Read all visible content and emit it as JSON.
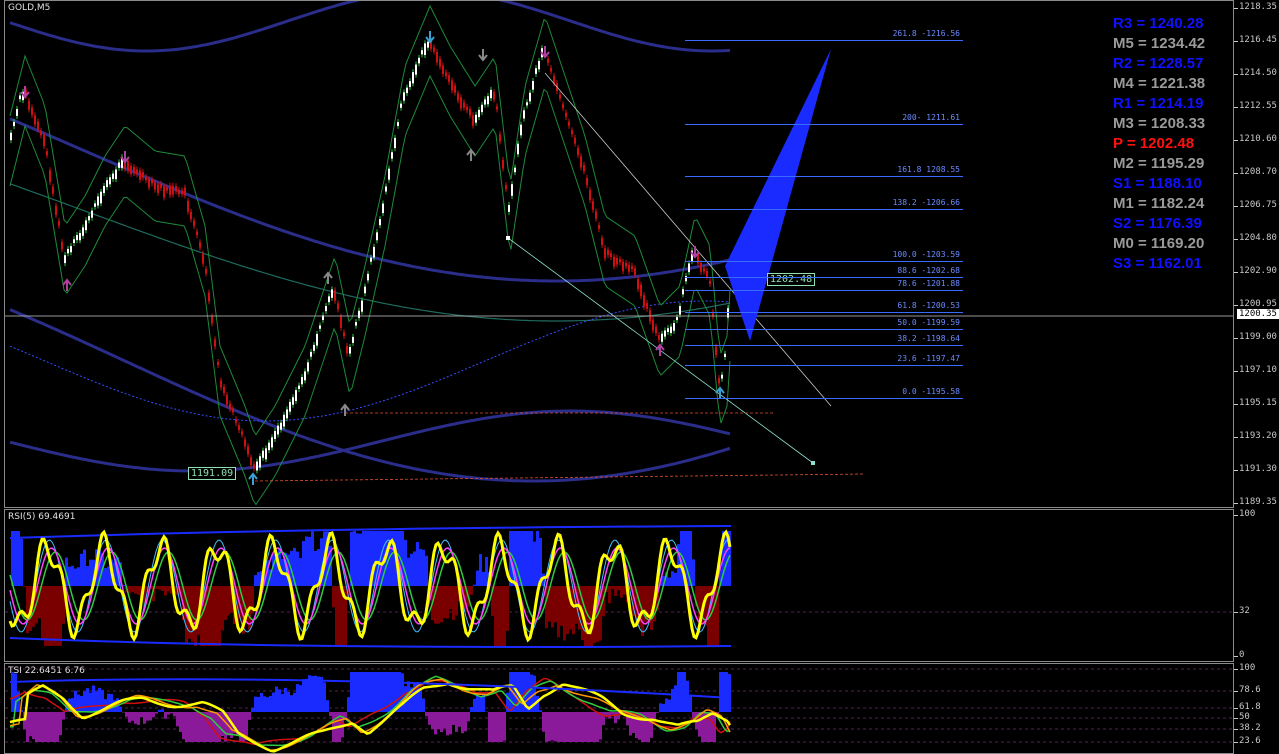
{
  "chart": {
    "title": "GOLD,M5",
    "current_price": "1200.35",
    "box_label_high": "1202.48",
    "box_label_low": "1191.09",
    "price_axis": [
      "1218.35",
      "1216.45",
      "1214.50",
      "1212.55",
      "1210.60",
      "1208.70",
      "1206.75",
      "1204.80",
      "1202.90",
      "1200.95",
      "1199.00",
      "1197.10",
      "1195.15",
      "1193.20",
      "1191.30",
      "1189.35"
    ],
    "fib_levels": [
      {
        "label": "261.8 -1216.56"
      },
      {
        "label": "200- 1211.61"
      },
      {
        "label": "161.8 1208.55"
      },
      {
        "label": "138.2 -1206.66"
      },
      {
        "label": "100.0 -1203.59"
      },
      {
        "label": "88.6 -1202.68"
      },
      {
        "label": "78.6 -1201.88"
      },
      {
        "label": "61.8 -1200.53"
      },
      {
        "label": "50.0 -1199.59"
      },
      {
        "label": "38.2 -1198.64"
      },
      {
        "label": "23.6 -1197.47"
      },
      {
        "label": "0.0 -1195.58"
      }
    ],
    "pivots": [
      {
        "text": "R3 = 1240.28",
        "color": "#1010ff"
      },
      {
        "text": "M5 = 1234.42",
        "color": "#9a9a9a"
      },
      {
        "text": "R2 = 1228.57",
        "color": "#1010ff"
      },
      {
        "text": "M4 = 1221.38",
        "color": "#9a9a9a"
      },
      {
        "text": "R1 = 1214.19",
        "color": "#1010ff"
      },
      {
        "text": "M3 = 1208.33",
        "color": "#9a9a9a"
      },
      {
        "text": "P   = 1202.48",
        "color": "#ff1010"
      },
      {
        "text": "M2 = 1195.29",
        "color": "#9a9a9a"
      },
      {
        "text": "S1 = 1188.10",
        "color": "#1010ff"
      },
      {
        "text": "M1 = 1182.24",
        "color": "#9a9a9a"
      },
      {
        "text": "S2 = 1176.39",
        "color": "#1010ff"
      },
      {
        "text": "M0 = 1169.20",
        "color": "#9a9a9a"
      },
      {
        "text": "S3 = 1162.01",
        "color": "#1010ff"
      }
    ]
  },
  "rsi_pane": {
    "title": "RSI(5) 69.4691",
    "axis": [
      "100",
      "32",
      "0"
    ]
  },
  "tsi_pane": {
    "title": "TSI 22.6451 6.76",
    "axis": [
      "100",
      "78.6",
      "61.8",
      "50",
      "38.2",
      "23.6"
    ]
  },
  "colors": {
    "up": "#2ecc40",
    "down": "#d01010",
    "blue": "#1a2bff",
    "yellow": "#ffff00"
  }
}
